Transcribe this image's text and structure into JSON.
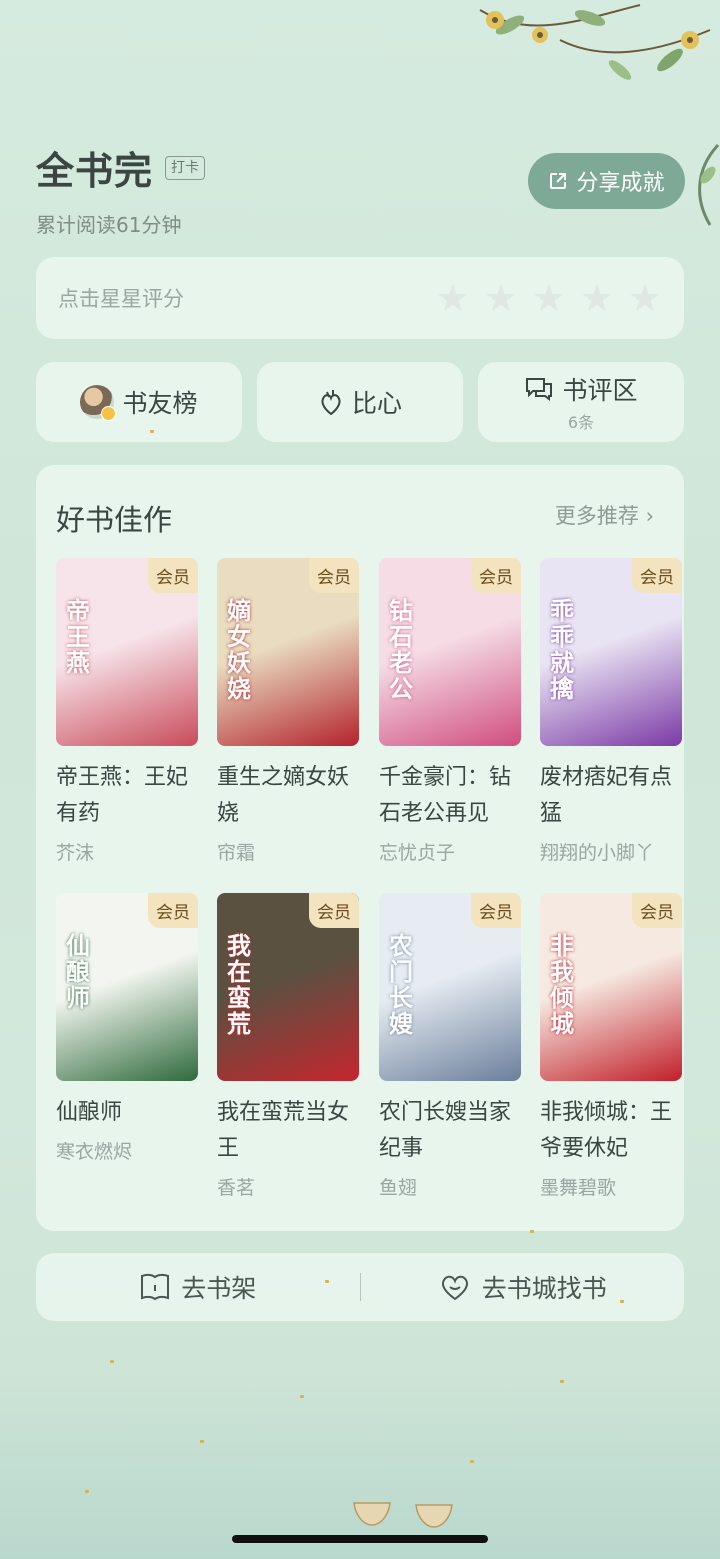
{
  "header": {
    "title": "全书完",
    "checkin_label": "打卡",
    "reading_time": "累计阅读61分钟",
    "share_label": "分享成就"
  },
  "rating": {
    "hint": "点击星星评分",
    "stars": 0,
    "max_stars": 5
  },
  "actions": {
    "friends_label": "书友榜",
    "heart_label": "比心",
    "comments_label": "书评区",
    "comments_count": "6条"
  },
  "recommend": {
    "title": "好书佳作",
    "more_label": "更多推荐",
    "books": [
      {
        "name": "帝王燕：王妃有药",
        "author": "芥沫",
        "badge": "会员",
        "cover_text": "帝王燕",
        "colors": [
          "#f7e4ea",
          "#c94b5a"
        ]
      },
      {
        "name": "重生之嫡女妖娆",
        "author": "帘霜",
        "badge": "会员",
        "cover_text": "嫡女妖娆",
        "colors": [
          "#e9dcc0",
          "#b3232d"
        ]
      },
      {
        "name": "千金豪门：钻石老公再见",
        "author": "忘忧贞子",
        "badge": "会员",
        "cover_text": "钻石老公",
        "colors": [
          "#f5dce5",
          "#d04d7f"
        ]
      },
      {
        "name": "废材痞妃有点猛",
        "author": "翔翔的小脚丫",
        "badge": "会员",
        "cover_text": "乖乖就擒",
        "colors": [
          "#e9e4f3",
          "#7b3aa6"
        ]
      },
      {
        "name": "仙酿师",
        "author": "寒衣燃烬",
        "badge": "会员",
        "cover_text": "仙酿师",
        "colors": [
          "#f3f6f0",
          "#2f6a3c"
        ]
      },
      {
        "name": "我在蛮荒当女王",
        "author": "香茗",
        "badge": "会员",
        "cover_text": "我在蛮荒",
        "colors": [
          "#5b5141",
          "#c4262e"
        ]
      },
      {
        "name": "农门长嫂当家纪事",
        "author": "鱼翅",
        "badge": "会员",
        "cover_text": "农门长嫂",
        "colors": [
          "#e6ecf2",
          "#6b7f9b"
        ]
      },
      {
        "name": "非我倾城：王爷要休妃",
        "author": "墨舞碧歌",
        "badge": "会员",
        "cover_text": "非我倾城",
        "colors": [
          "#f6e9e1",
          "#c21f2a"
        ]
      }
    ]
  },
  "bottom": {
    "shelf_label": "去书架",
    "store_label": "去书城找书"
  }
}
